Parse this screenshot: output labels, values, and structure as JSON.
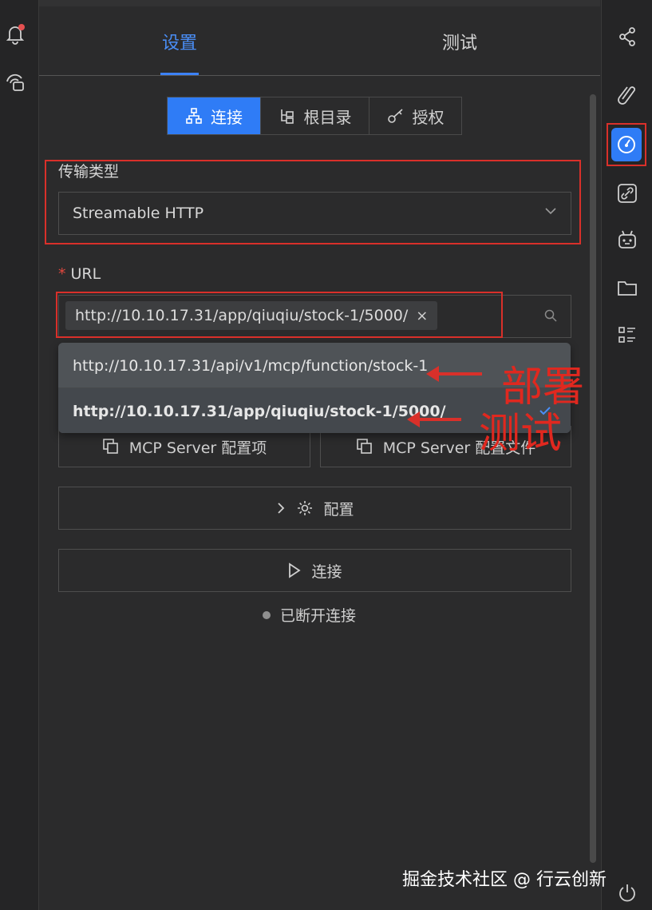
{
  "tabs": {
    "settings": "设置",
    "test": "测试"
  },
  "segments": [
    {
      "label": "连接",
      "icon": "sitemap-icon"
    },
    {
      "label": "根目录",
      "icon": "tree-icon"
    },
    {
      "label": "授权",
      "icon": "key-icon"
    }
  ],
  "transport": {
    "label": "传输类型",
    "value": "Streamable HTTP"
  },
  "url": {
    "label": "URL",
    "required_mark": "*",
    "tag_value": "http://10.10.17.31/app/qiuqiu/stock-1/5000/",
    "tag_close": "×"
  },
  "dropdown": {
    "options": [
      "http://10.10.17.31/api/v1/mcp/function/stock-1",
      "http://10.10.17.31/app/qiuqiu/stock-1/5000/"
    ]
  },
  "buttons": {
    "server_config_item": "MCP Server 配置项",
    "server_config_file": "MCP Server 配置文件",
    "config": "配置",
    "connect": "连接"
  },
  "status": {
    "text": "已断开连接"
  },
  "annotations": {
    "deploy": "部署",
    "test": "测试"
  },
  "watermark": "掘金技术社区 @ 行云创新",
  "colors": {
    "accent": "#2f7cf6",
    "annotation_red": "#d9302a"
  }
}
